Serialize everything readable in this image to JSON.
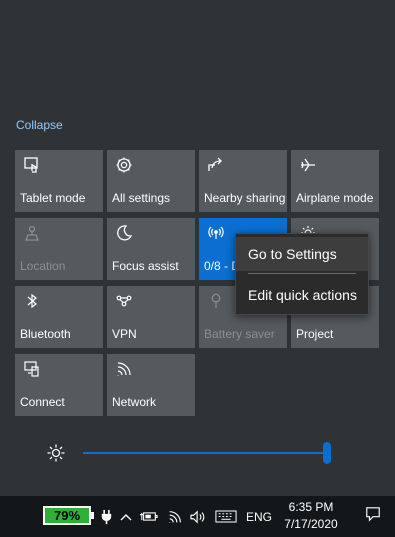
{
  "collapse_label": "Collapse",
  "tiles": [
    {
      "label": "Tablet mode",
      "icon": "tablet-mode-icon",
      "state": "normal"
    },
    {
      "label": "All settings",
      "icon": "gear-icon",
      "state": "normal"
    },
    {
      "label": "Nearby sharing",
      "icon": "share-icon",
      "state": "normal"
    },
    {
      "label": "Airplane mode",
      "icon": "airplane-icon",
      "state": "normal"
    },
    {
      "label": "Location",
      "icon": "location-icon",
      "state": "disabled"
    },
    {
      "label": "Focus assist",
      "icon": "moon-icon",
      "state": "normal"
    },
    {
      "label": "0/8 - D",
      "icon": "wireless-display-icon",
      "state": "active"
    },
    {
      "label": "",
      "icon": "brightness-small-icon",
      "state": "normal"
    },
    {
      "label": "Bluetooth",
      "icon": "bluetooth-icon",
      "state": "normal"
    },
    {
      "label": "VPN",
      "icon": "vpn-icon",
      "state": "normal"
    },
    {
      "label": "Battery saver",
      "icon": "leaf-icon",
      "state": "disabled"
    },
    {
      "label": "Project",
      "icon": "project-icon",
      "state": "normal"
    },
    {
      "label": "Connect",
      "icon": "connect-icon",
      "state": "normal"
    },
    {
      "label": "Network",
      "icon": "network-icon",
      "state": "normal"
    }
  ],
  "context_menu": {
    "items": [
      "Go to Settings",
      "Edit quick actions"
    ]
  },
  "brightness": {
    "level": 1.0
  },
  "taskbar": {
    "battery_percent": "79%",
    "language": "ENG",
    "time": "6:35 PM",
    "date": "7/17/2020"
  },
  "colors": {
    "accent": "#0a6fd1",
    "tile": "#555a5e",
    "panel": "#2f3336",
    "battery_fill": "#2fb03a"
  }
}
